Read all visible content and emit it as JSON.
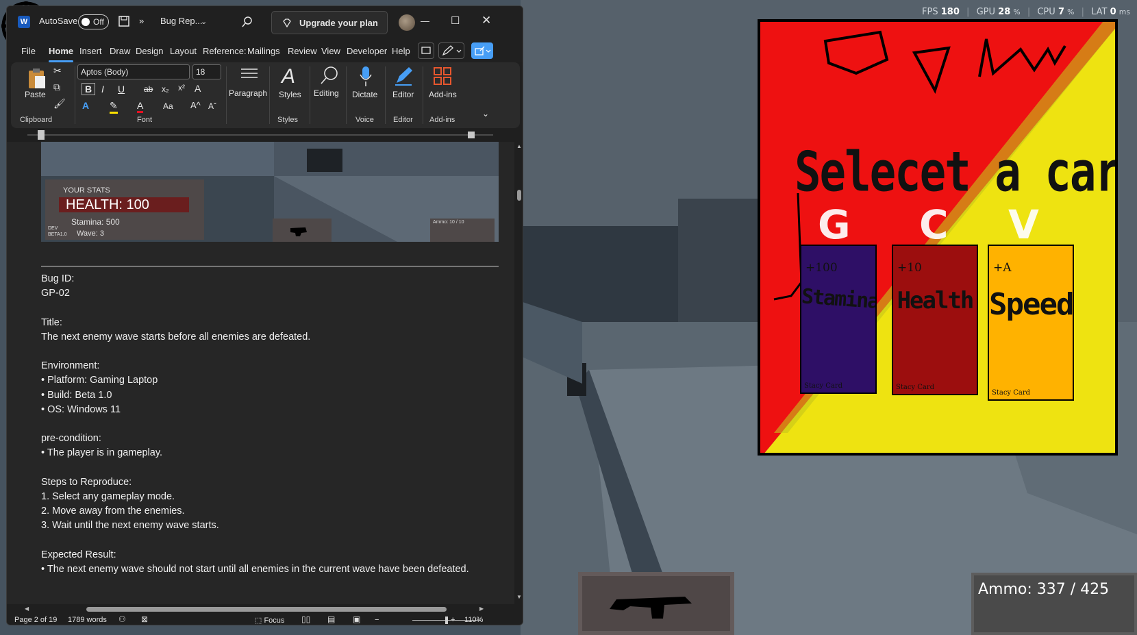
{
  "word": {
    "app_icon": "W",
    "autosave_label": "AutoSave",
    "autosave_state": "Off",
    "doc_name": "Bug Rep...",
    "upgrade_label": "Upgrade your plan",
    "menu": [
      "File",
      "Home",
      "Insert",
      "Draw",
      "Design",
      "Layout",
      "Reference:",
      "Mailings",
      "Review",
      "View",
      "Developer",
      "Help"
    ],
    "active_menu": "Home",
    "ribbon": {
      "paste": "Paste",
      "clipboard": "Clipboard",
      "font_name": "Aptos (Body)",
      "font_size": "18",
      "font": "Font",
      "paragraph": "Paragraph",
      "styles_btn": "Styles",
      "styles": "Styles",
      "editing": "Editing",
      "dictate": "Dictate",
      "voice": "Voice",
      "editor_btn": "Editor",
      "editor": "Editor",
      "addins_btn": "Add-ins",
      "addins": "Add-ins"
    },
    "doc_screenshot": {
      "stats_label": "YOUR STATS",
      "health": "HEALTH: 100",
      "stamina": "Stamina: 500",
      "dev": "DEV",
      "build": "BETA1.0",
      "wave": "Wave: 3",
      "ammo": "Ammo: 10 / 10"
    },
    "document": {
      "bug_id_label": "Bug ID:",
      "bug_id": "GP-02",
      "title_label": "Title:",
      "title": "The next enemy wave starts before all enemies are defeated.",
      "environment_label": "Environment:",
      "environment": [
        "• Platform: Gaming Laptop",
        "• Build: Beta 1.0",
        "• OS: Windows 11"
      ],
      "precondition_label": "pre-condition:",
      "precondition": "• The player is in gameplay.",
      "steps_label": "Steps to Reproduce:",
      "steps": [
        "1. Select any gameplay mode.",
        "2. Move away from the enemies.",
        "3. Wait until the next enemy wave starts."
      ],
      "expected_label": "Expected Result:",
      "expected": "• The next enemy wave should not start until all enemies in the current wave have been defeated."
    },
    "status": {
      "page": "Page 2 of 19",
      "words": "1789 words",
      "focus": "Focus",
      "zoom": "110%"
    }
  },
  "perf": {
    "fps_label": "FPS",
    "fps": "180",
    "gpu_label": "GPU",
    "gpu": "28",
    "cpu_label": "CPU",
    "cpu": "7",
    "lat_label": "LAT",
    "lat": "0",
    "pct": "%",
    "ms": "ms"
  },
  "game": {
    "title": "Selecet a card!",
    "letters": [
      "G",
      "C",
      "V"
    ],
    "cards": [
      {
        "bonus": "+100",
        "name": "Stamina",
        "footer": "Stacy Card",
        "color": "#2e0f66"
      },
      {
        "bonus": "+10",
        "name": "Health",
        "footer": "Stacy Card",
        "color": "#9c0e0e"
      },
      {
        "bonus": "+A",
        "name": "Speed",
        "footer": "Stacy Card",
        "color": "#ffb200"
      }
    ],
    "ammo": "Ammo: 337 / 425",
    "colors": {
      "red": "#ee1111",
      "yellow": "#eee311"
    }
  }
}
